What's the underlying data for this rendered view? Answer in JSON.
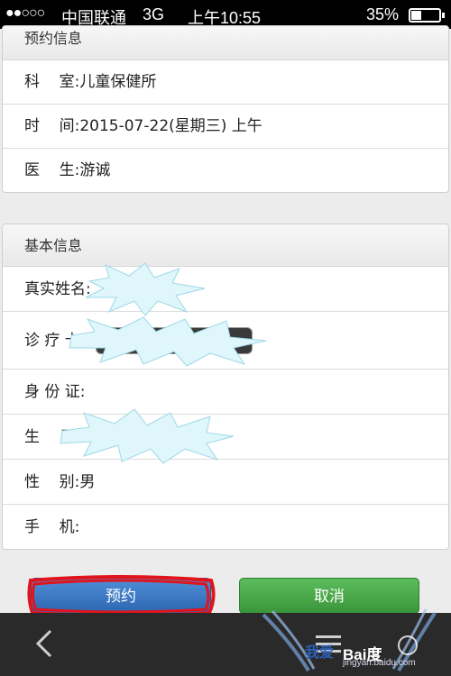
{
  "status_bar": {
    "signal": "●●○○○",
    "carrier": "中国联通",
    "network": "3G",
    "time": "上午10:55",
    "battery_text": "35%",
    "battery_level": 0.35
  },
  "appointment_info": {
    "title": "预约信息",
    "rows": [
      {
        "label": "科    室:",
        "value": "儿童保健所"
      },
      {
        "label": "时    间:",
        "value": "2015-07-22(星期三) 上午"
      },
      {
        "label": "医    生:",
        "value": "游诚"
      }
    ]
  },
  "basic_info": {
    "title": "基本信息",
    "rows": [
      {
        "label": "真实姓名:",
        "value": ""
      },
      {
        "label": "诊 疗 卡:",
        "value": ""
      },
      {
        "label": "身 份 证:",
        "value": ""
      },
      {
        "label": "生    日:",
        "value": ""
      },
      {
        "label": "性    别:",
        "value": "男"
      },
      {
        "label": "手    机:",
        "value": ""
      }
    ]
  },
  "buttons": {
    "book": "预约",
    "cancel": "取消"
  },
  "watermark": {
    "logo_text": "Bai度",
    "site": "jingyan.baidu.com",
    "left_text": "我爱"
  },
  "colors": {
    "book_button": "#3a78c4",
    "cancel_button": "#4aa84a",
    "highlight_scribble": "#e0141c",
    "redaction": "#dff6fb"
  }
}
